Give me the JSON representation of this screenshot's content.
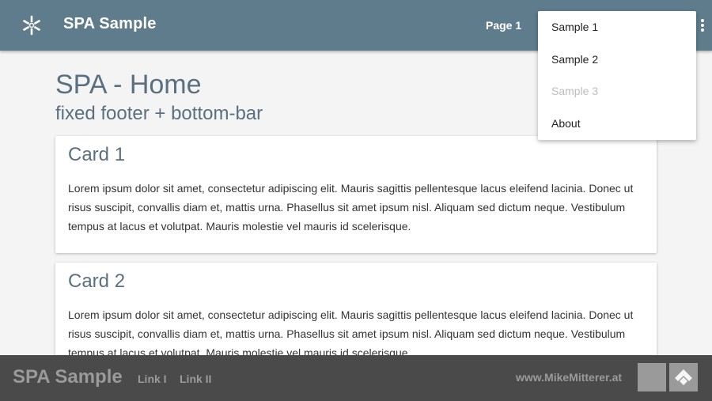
{
  "header": {
    "app_title": "SPA Sample",
    "logo_icon": "snowflake-icon",
    "nav_link": "Page 1",
    "more_icon": "more-vert-icon",
    "color": "#5e7c8c"
  },
  "menu": {
    "items": [
      {
        "label": "Sample 1",
        "disabled": false
      },
      {
        "label": "Sample 2",
        "disabled": false
      },
      {
        "label": "Sample 3",
        "disabled": true
      },
      {
        "label": "About",
        "disabled": false
      }
    ]
  },
  "main": {
    "title": "SPA - Home",
    "subtitle": "fixed footer + bottom-bar",
    "cards": [
      {
        "title": "Card 1",
        "text": "Lorem ipsum dolor sit amet, consectetur adipiscing elit. Mauris sagittis pellentesque lacus eleifend lacinia. Donec ut risus suscipit, convallis diam et, mattis urna. Phasellus sit amet ipsum nisl. Aliquam sed dictum neque. Vestibulum tempus at lacus et volutpat. Mauris molestie vel mauris id scelerisque."
      },
      {
        "title": "Card 2",
        "text": "Lorem ipsum dolor sit amet, consectetur adipiscing elit. Mauris sagittis pellentesque lacus eleifend lacinia. Donec ut risus suscipit, convallis diam et, mattis urna. Phasellus sit amet ipsum nisl. Aliquam sed dictum neque. Vestibulum tempus at lacus et volutpat. Mauris molestie vel mauris id scelerisque."
      }
    ]
  },
  "footer": {
    "title": "SPA Sample",
    "link1": "Link I",
    "link2": "Link II",
    "site": "www.MikeMitterer.at",
    "feed_icon": "feedly-icon",
    "color": "#4a4a4a"
  }
}
